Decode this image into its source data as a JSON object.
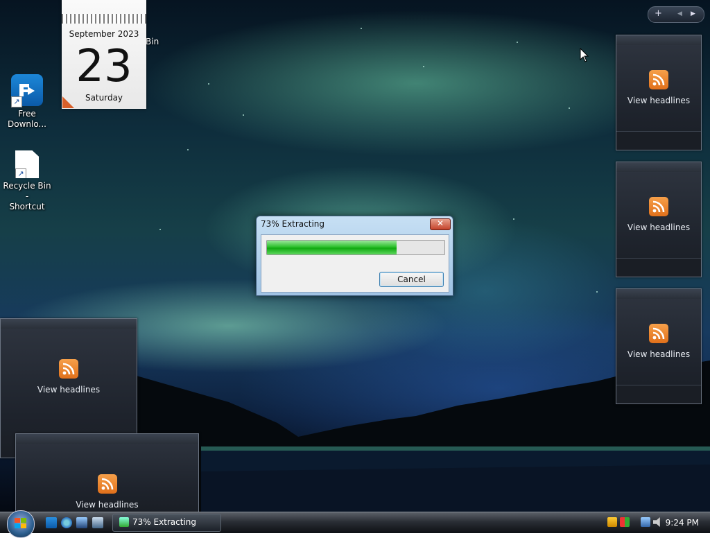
{
  "desktop": {
    "icons": [
      {
        "label": "Free\nDownlo...",
        "type": "app"
      },
      {
        "label": "Recycle Bin -\nShortcut",
        "type": "shortcut"
      }
    ],
    "overlap_text": "Bin"
  },
  "calendar": {
    "month_year": "September 2023",
    "day": "23",
    "weekday": "Saturday"
  },
  "sidebar": {
    "add_label": "+",
    "prev_label": "◀",
    "next_label": "▶"
  },
  "feeds": [
    {
      "label": "View headlines"
    },
    {
      "label": "View headlines"
    },
    {
      "label": "View headlines"
    },
    {
      "label": "View headlines"
    },
    {
      "label": "View headlines"
    }
  ],
  "dialog": {
    "title": "73% Extracting",
    "close_label": "✕",
    "progress_percent": 73,
    "cancel_label": "Cancel"
  },
  "taskbar": {
    "task_title": "73% Extracting",
    "clock": "9:24 PM"
  },
  "colors": {
    "progress_green": "#10a910",
    "rss_orange": "#e0701b",
    "close_red": "#c5432b"
  }
}
